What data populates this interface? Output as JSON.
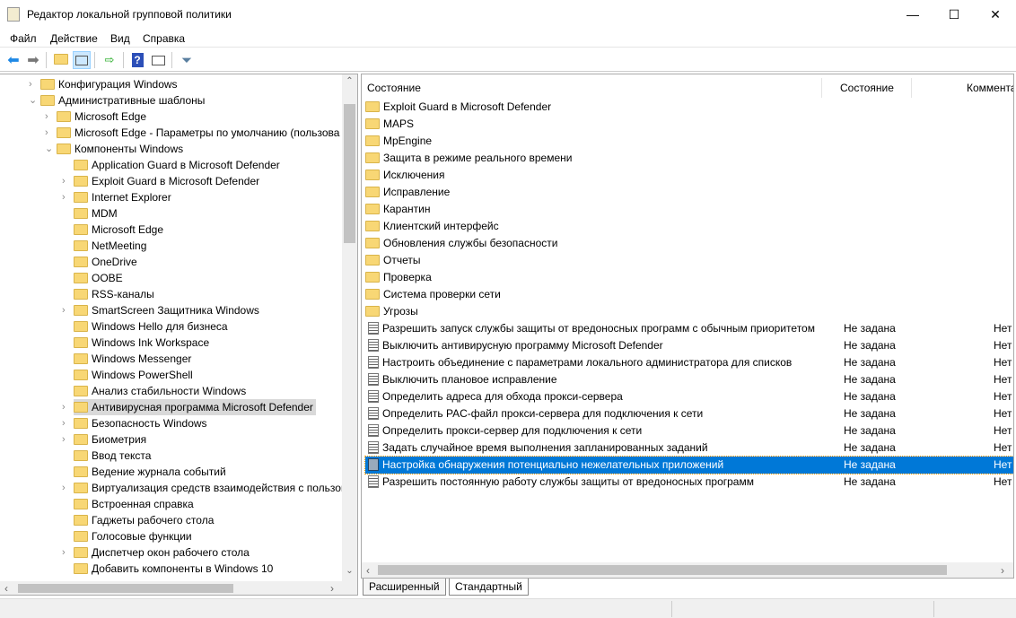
{
  "window": {
    "title": "Редактор локальной групповой политики",
    "minimize": "—",
    "maximize": "☐",
    "close": "✕"
  },
  "menu": [
    "Файл",
    "Действие",
    "Вид",
    "Справка"
  ],
  "toolbar": [
    "back-icon",
    "forward-icon",
    "up-folder-icon",
    "show-hide-tree-icon",
    "export-list-icon",
    "help-icon",
    "show-action-pane-icon",
    "filter-icon"
  ],
  "tree": [
    {
      "label": "Конфигурация Windows",
      "level": 0,
      "expander": "collapsed"
    },
    {
      "label": "Административные шаблоны",
      "level": 0,
      "expander": "expanded"
    },
    {
      "label": "Microsoft Edge",
      "level": 1,
      "expander": "collapsed"
    },
    {
      "label": "Microsoft Edge - Параметры по умолчанию (пользова",
      "level": 1,
      "expander": "collapsed"
    },
    {
      "label": "Компоненты Windows",
      "level": 1,
      "expander": "expanded"
    },
    {
      "label": "Application Guard в Microsoft Defender",
      "level": 2,
      "expander": "none"
    },
    {
      "label": "Exploit Guard в Microsoft Defender",
      "level": 2,
      "expander": "collapsed"
    },
    {
      "label": "Internet Explorer",
      "level": 2,
      "expander": "collapsed"
    },
    {
      "label": "MDM",
      "level": 2,
      "expander": "none"
    },
    {
      "label": "Microsoft Edge",
      "level": 2,
      "expander": "none"
    },
    {
      "label": "NetMeeting",
      "level": 2,
      "expander": "none"
    },
    {
      "label": "OneDrive",
      "level": 2,
      "expander": "none"
    },
    {
      "label": "OOBE",
      "level": 2,
      "expander": "none"
    },
    {
      "label": "RSS-каналы",
      "level": 2,
      "expander": "none"
    },
    {
      "label": "SmartScreen Защитника Windows",
      "level": 2,
      "expander": "collapsed"
    },
    {
      "label": "Windows Hello для бизнеса",
      "level": 2,
      "expander": "none"
    },
    {
      "label": "Windows Ink Workspace",
      "level": 2,
      "expander": "none"
    },
    {
      "label": "Windows Messenger",
      "level": 2,
      "expander": "none"
    },
    {
      "label": "Windows PowerShell",
      "level": 2,
      "expander": "none"
    },
    {
      "label": "Анализ стабильности Windows",
      "level": 2,
      "expander": "none"
    },
    {
      "label": "Антивирусная программа Microsoft Defender",
      "level": 2,
      "expander": "collapsed",
      "selected": true
    },
    {
      "label": "Безопасность Windows",
      "level": 2,
      "expander": "collapsed"
    },
    {
      "label": "Биометрия",
      "level": 2,
      "expander": "collapsed"
    },
    {
      "label": "Ввод текста",
      "level": 2,
      "expander": "none"
    },
    {
      "label": "Ведение журнала событий",
      "level": 2,
      "expander": "none"
    },
    {
      "label": "Виртуализация средств взаимодействия с пользов",
      "level": 2,
      "expander": "collapsed"
    },
    {
      "label": "Встроенная справка",
      "level": 2,
      "expander": "none"
    },
    {
      "label": "Гаджеты рабочего стола",
      "level": 2,
      "expander": "none"
    },
    {
      "label": "Голосовые функции",
      "level": 2,
      "expander": "none"
    },
    {
      "label": "Диспетчер окон рабочего стола",
      "level": 2,
      "expander": "collapsed"
    },
    {
      "label": "Добавить компоненты в Windows 10",
      "level": 2,
      "expander": "none"
    }
  ],
  "list": {
    "columns": [
      "Состояние",
      "Состояние",
      "Коммента"
    ],
    "folders": [
      "Exploit Guard в Microsoft Defender",
      "MAPS",
      "MpEngine",
      "Защита в режиме реального времени",
      "Исключения",
      "Исправление",
      "Карантин",
      "Клиентский интерфейс",
      "Обновления службы безопасности",
      "Отчеты",
      "Проверка",
      "Система проверки сети",
      "Угрозы"
    ],
    "settings": [
      {
        "name": "Разрешить запуск службы защиты от вредоносных программ с обычным приоритетом",
        "state": "Не задана",
        "comment": "Нет"
      },
      {
        "name": "Выключить антивирусную программу Microsoft Defender",
        "state": "Не задана",
        "comment": "Нет"
      },
      {
        "name": "Настроить объединение с параметрами локального администратора для списков",
        "state": "Не задана",
        "comment": "Нет"
      },
      {
        "name": "Выключить плановое исправление",
        "state": "Не задана",
        "comment": "Нет"
      },
      {
        "name": "Определить адреса для обхода прокси-сервера",
        "state": "Не задана",
        "comment": "Нет"
      },
      {
        "name": "Определить PAC-файл прокси-сервера для подключения к сети",
        "state": "Не задана",
        "comment": "Нет"
      },
      {
        "name": "Определить прокси-сервер для подключения к сети",
        "state": "Не задана",
        "comment": "Нет"
      },
      {
        "name": "Задать случайное время выполнения запланированных заданий",
        "state": "Не задана",
        "comment": "Нет"
      },
      {
        "name": "Настройка обнаружения потенциально нежелательных приложений",
        "state": "Не задана",
        "comment": "Нет",
        "selected": true
      },
      {
        "name": "Разрешить постоянную работу службы защиты от вредоносных программ",
        "state": "Не задана",
        "comment": "Нет"
      }
    ]
  },
  "tabs": [
    "Расширенный",
    "Стандартный"
  ],
  "colors": {
    "selection": "#0078d7",
    "tree_selection": "#d9d9d9",
    "folder": "#f8d775"
  }
}
